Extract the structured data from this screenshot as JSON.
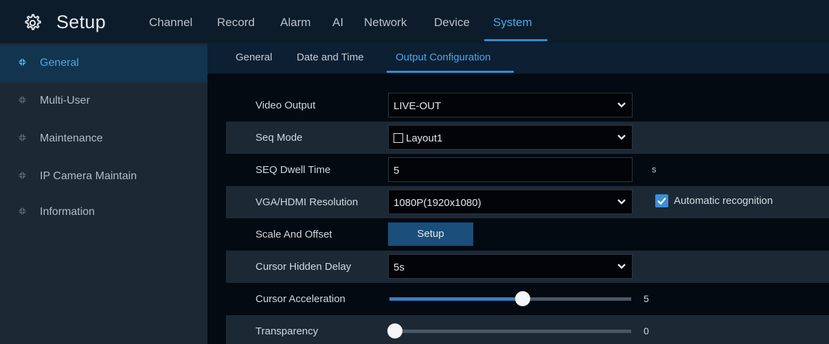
{
  "header": {
    "title": "Setup",
    "icon": "gear-icon",
    "nav": [
      {
        "label": "Channel"
      },
      {
        "label": "Record"
      },
      {
        "label": "Alarm"
      },
      {
        "label": "AI"
      },
      {
        "label": "Network"
      },
      {
        "label": "Device"
      },
      {
        "label": "System",
        "active": true
      }
    ]
  },
  "sidebar": {
    "items": [
      {
        "label": "General",
        "active": true
      },
      {
        "label": "Multi-User"
      },
      {
        "label": "Maintenance"
      },
      {
        "label": "IP Camera Maintain"
      },
      {
        "label": "Information"
      }
    ]
  },
  "tabs": [
    {
      "label": "General"
    },
    {
      "label": "Date and Time"
    },
    {
      "label": "Output Configuration",
      "active": true
    }
  ],
  "form": {
    "video_output": {
      "label": "Video Output",
      "value": "LIVE-OUT"
    },
    "seq_mode": {
      "label": "Seq Mode",
      "value": "Layout1",
      "checked": false
    },
    "seq_dwell": {
      "label": "SEQ Dwell Time",
      "value": "5",
      "unit": "s"
    },
    "resolution": {
      "label": "VGA/HDMI Resolution",
      "value": "1080P(1920x1080)",
      "auto_label": "Automatic recognition",
      "auto_checked": true
    },
    "scale_offset": {
      "label": "Scale And Offset",
      "button": "Setup"
    },
    "cursor_delay": {
      "label": "Cursor Hidden Delay",
      "value": "5s"
    },
    "cursor_accel": {
      "label": "Cursor Acceleration",
      "value": "5",
      "fraction": 0.55
    },
    "transparency": {
      "label": "Transparency",
      "value": "0",
      "fraction": 0.0
    }
  },
  "colors": {
    "accent": "#4aa8e8",
    "header_bg": "#0d1c2a",
    "sidebar_bg": "#1c2935",
    "main_bg": "#030a11",
    "button_bg": "#1b4e7a",
    "checkbox": "#3c8fd6"
  }
}
